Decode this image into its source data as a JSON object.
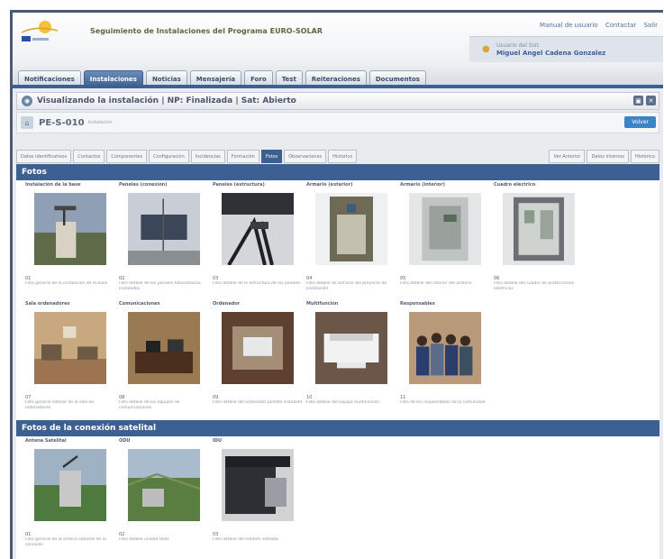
{
  "header": {
    "app_title": "Seguimiento de Instalaciones del Programa EURO-SOLAR",
    "links": [
      "Manual de usuario",
      "Contactar",
      "Salir"
    ],
    "user_role": "Usuario del Sist.",
    "user_name": "Miguel Angel Cadena Gonzalez"
  },
  "main_nav": [
    "Notificaciones",
    "Instalaciones",
    "Noticias",
    "Mensajería",
    "Foro",
    "Test",
    "Reiteraciones",
    "Documentos"
  ],
  "active_nav": 1,
  "page_title": "Visualizando la instalación | NP: Finalizada | Sat: Abierto",
  "record": {
    "code": "PE-S-010",
    "subtitle": "Instalación",
    "back_label": "Volver"
  },
  "sub_tabs": [
    "Datos identificativos",
    "Contactos",
    "Componentes",
    "Configuración",
    "Incidencias",
    "Formación",
    "Fotos",
    "Observaciones",
    "Historico"
  ],
  "sub_tabs_right": [
    "Ver Anterior",
    "Datos internos",
    "Histórico"
  ],
  "active_sub_tab": 6,
  "sections": [
    {
      "title": "Fotos",
      "cards": [
        {
          "title": "Instalación de la base",
          "num": "01",
          "desc": "Foto general de la instalación de la base"
        },
        {
          "title": "Paneles (conexión)",
          "num": "02",
          "desc": "Foto detalle de los paneles fotovoltaicos instalados"
        },
        {
          "title": "Paneles (estructura)",
          "num": "03",
          "desc": "Foto detalle de la estructura de los paneles"
        },
        {
          "title": "Armario (exterior)",
          "num": "04",
          "desc": "Foto detalle de armario del proyecto de instalación"
        },
        {
          "title": "Armario (interior)",
          "num": "05",
          "desc": "Foto detalle del interior del armario"
        },
        {
          "title": "Cuadro eléctrico",
          "num": "06",
          "desc": "Foto detalle del cuadro de protecciones eléctricas"
        },
        {
          "title": "Sala ordenadores",
          "num": "07",
          "desc": "Foto general interior de la sala de ordenadores"
        },
        {
          "title": "Comunicaciones",
          "num": "08",
          "desc": "Foto detalle de los equipos de comunicaciones"
        },
        {
          "title": "Ordenador",
          "num": "09",
          "desc": "Foto detalle del ordenador portátil instalado"
        },
        {
          "title": "Multifunción",
          "num": "10",
          "desc": "Foto detalle del equipo multifunción"
        },
        {
          "title": "Responsables",
          "num": "11",
          "desc": "Foto de los responsables de la comunidad"
        }
      ]
    },
    {
      "title": "Fotos de la conexión satelital",
      "cards": [
        {
          "title": "Antena Satelital",
          "num": "01",
          "desc": "Foto general de la antena satelital de la conexión"
        },
        {
          "title": "ODU",
          "num": "02",
          "desc": "Foto detalle unidad ODU"
        },
        {
          "title": "IDU",
          "num": "03",
          "desc": "Foto detalle del módem satelital"
        }
      ]
    }
  ],
  "colors": {
    "accent": "#3d6092",
    "header_text": "#5a6b3a",
    "button": "#3a85c8"
  }
}
